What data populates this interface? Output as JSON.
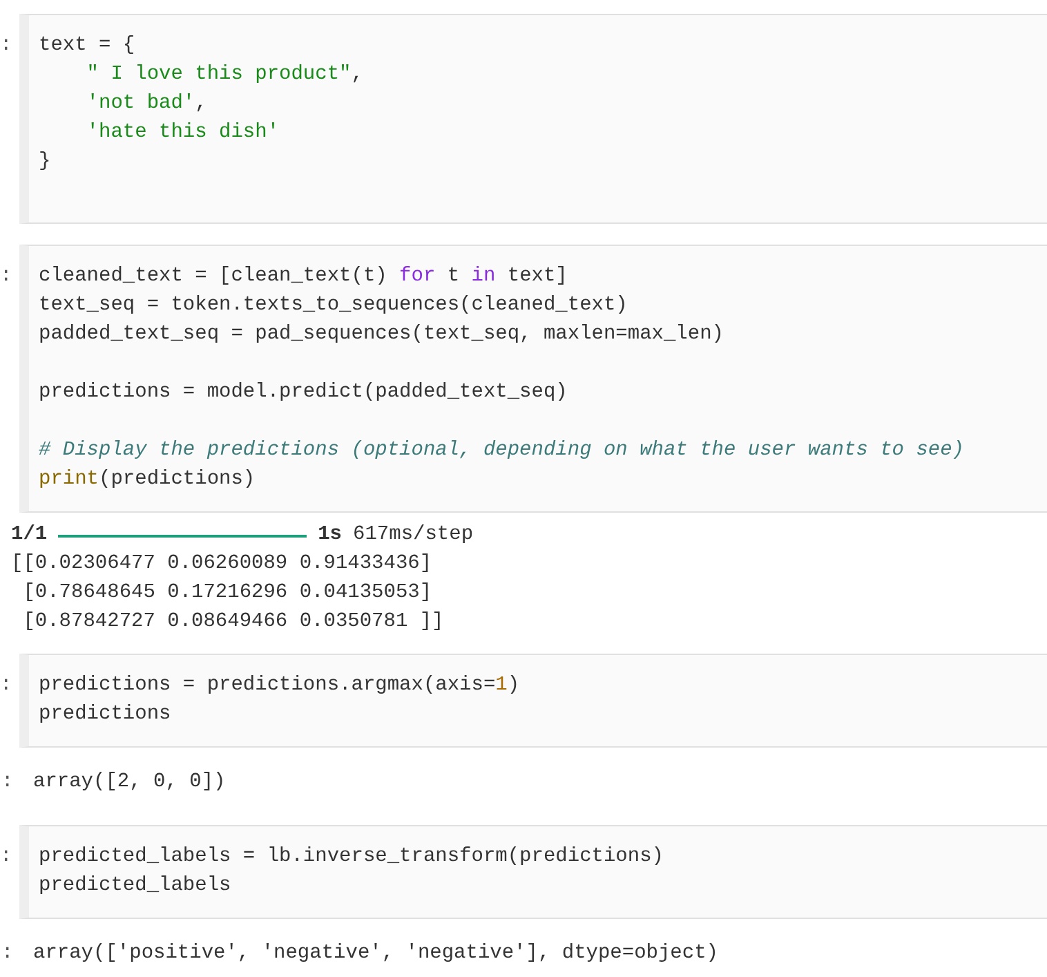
{
  "cells": [
    {
      "kind": "code",
      "prompt": ":",
      "lines": [
        {
          "kind": "code",
          "tokens": [
            {
              "kind": "plain",
              "t": "text = {"
            }
          ]
        },
        {
          "kind": "code",
          "tokens": [
            {
              "kind": "string",
              "t": "    \" I love this product\""
            },
            {
              "kind": "plain",
              "t": ","
            }
          ]
        },
        {
          "kind": "code",
          "tokens": [
            {
              "kind": "string",
              "t": "    'not bad'"
            },
            {
              "kind": "plain",
              "t": ","
            }
          ]
        },
        {
          "kind": "code",
          "tokens": [
            {
              "kind": "string",
              "t": "    'hate this dish'"
            }
          ]
        },
        {
          "kind": "code",
          "tokens": [
            {
              "kind": "plain",
              "t": "}"
            }
          ]
        },
        {
          "kind": "blank"
        }
      ]
    },
    {
      "kind": "code",
      "prompt": ":",
      "lines": [
        {
          "kind": "code",
          "tokens": [
            {
              "kind": "plain",
              "t": "cleaned_text = [clean_text(t) "
            },
            {
              "kind": "keyword",
              "t": "for"
            },
            {
              "kind": "plain",
              "t": " t "
            },
            {
              "kind": "keyword",
              "t": "in"
            },
            {
              "kind": "plain",
              "t": " text]"
            }
          ]
        },
        {
          "kind": "code",
          "tokens": [
            {
              "kind": "plain",
              "t": "text_seq = token.texts_to_sequences(cleaned_text)"
            }
          ]
        },
        {
          "kind": "code",
          "tokens": [
            {
              "kind": "plain",
              "t": "padded_text_seq = pad_sequences(text_seq, maxlen=max_len)"
            }
          ]
        },
        {
          "kind": "blank"
        },
        {
          "kind": "code",
          "tokens": [
            {
              "kind": "plain",
              "t": "predictions = model.predict(padded_text_seq)"
            }
          ]
        },
        {
          "kind": "blank"
        },
        {
          "kind": "code",
          "tokens": [
            {
              "kind": "comment",
              "t": "# Display the predictions (optional, depending on what the user wants to see)"
            }
          ]
        },
        {
          "kind": "code",
          "tokens": [
            {
              "kind": "builtin",
              "t": "print"
            },
            {
              "kind": "plain",
              "t": "(predictions)"
            }
          ]
        }
      ]
    },
    {
      "kind": "stream",
      "progress": {
        "count": "1/1",
        "level": 1,
        "time": "1s",
        "rate": "617ms/step"
      },
      "lines": [
        "[[0.02306477 0.06260089 0.91433436]",
        " [0.78648645 0.17216296 0.04135053]",
        " [0.87842727 0.08649466 0.0350781 ]]"
      ]
    },
    {
      "kind": "code",
      "prompt": ":",
      "lines": [
        {
          "kind": "code",
          "tokens": [
            {
              "kind": "plain",
              "t": "predictions = predictions.argmax(axis="
            },
            {
              "kind": "number",
              "t": "1"
            },
            {
              "kind": "plain",
              "t": ")"
            }
          ]
        },
        {
          "kind": "code",
          "tokens": [
            {
              "kind": "plain",
              "t": "predictions"
            }
          ]
        }
      ]
    },
    {
      "kind": "result",
      "prompt": ":",
      "text": "array([2, 0, 0])"
    },
    {
      "kind": "code",
      "prompt": ":",
      "lines": [
        {
          "kind": "code",
          "tokens": [
            {
              "kind": "plain",
              "t": "predicted_labels = lb.inverse_transform(predictions)"
            }
          ]
        },
        {
          "kind": "code",
          "tokens": [
            {
              "kind": "plain",
              "t": "predicted_labels"
            }
          ]
        }
      ]
    },
    {
      "kind": "result",
      "prompt": ":",
      "text": "array(['positive', 'negative', 'negative'], dtype=object)"
    }
  ]
}
